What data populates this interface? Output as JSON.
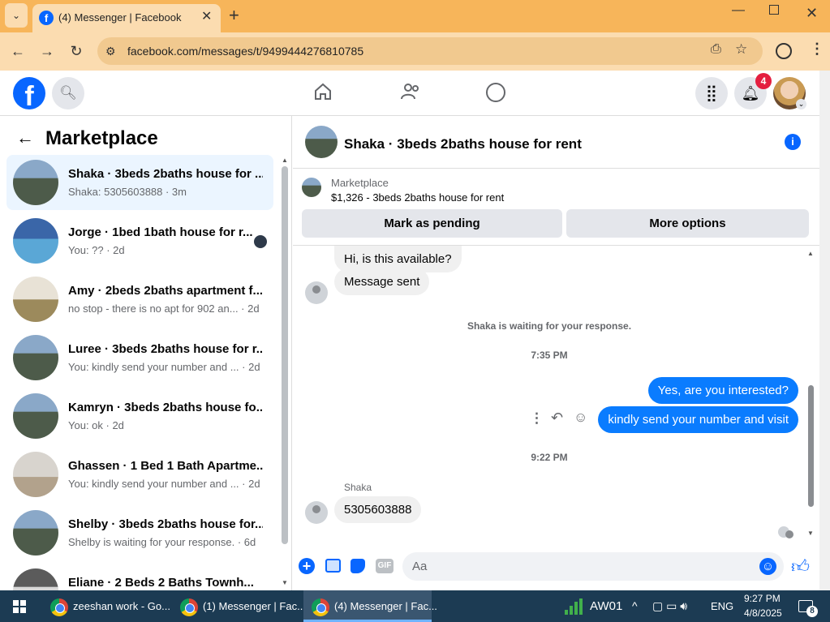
{
  "browser": {
    "tab_title": "(4) Messenger | Facebook",
    "url": "facebook.com/messages/t/9499444276810785"
  },
  "fb": {
    "notif_count": "4"
  },
  "left": {
    "title": "Marketplace",
    "conversations": [
      {
        "title": "Shaka · 3beds 2baths house for ...",
        "sub": "Shaka: 5305603888 · 3m"
      },
      {
        "title": "Jorge · 1bed 1bath house for r...",
        "sub": "You: ?? · 2d"
      },
      {
        "title": "Amy · 2beds 2baths apartment f...",
        "sub": "no stop - there is no apt for 902 an... · 2d"
      },
      {
        "title": "Luree · 3beds 2baths house for r...",
        "sub": "You: kindly send your number and ... · 2d"
      },
      {
        "title": "Kamryn · 3beds 2baths house fo...",
        "sub": "You: ok · 2d"
      },
      {
        "title": "Ghassen · 1 Bed 1 Bath Apartme...",
        "sub": "You: kindly send your number and ... · 2d"
      },
      {
        "title": "Shelby · 3beds 2baths house for...",
        "sub": "Shelby is waiting for your response. · 6d"
      },
      {
        "title": "Eliane · 2 Beds 2 Baths Townh...",
        "sub": ""
      }
    ]
  },
  "chat": {
    "header_title": "Shaka · 3beds 2baths house for rent",
    "listing_source": "Marketplace",
    "listing_desc": "$1,326 - 3beds 2baths house for rent",
    "mark_pending": "Mark as pending",
    "more_options": "More options",
    "msg1": "Hi, is this available?",
    "msg2": "Message sent",
    "waiting": "Shaka is waiting for your response.",
    "time1": "7:35 PM",
    "out1": "Yes, are you interested?",
    "out2": "kindly send your number and visit",
    "time2": "9:22 PM",
    "sender": "Shaka",
    "in3": "5305603888",
    "composer_placeholder": "Aa",
    "gif_label": "GIF"
  },
  "taskbar": {
    "item1": "zeeshan work - Go...",
    "item2": "(1) Messenger | Fac...",
    "item3": "(4) Messenger | Fac...",
    "network": "AW01",
    "lang": "ENG",
    "time": "9:27 PM",
    "date": "4/8/2025",
    "notif": "8"
  },
  "colors": {
    "fb_blue": "#0866ff",
    "bubble_blue": "#0a7cff",
    "chrome_orange": "#f7b55a"
  }
}
